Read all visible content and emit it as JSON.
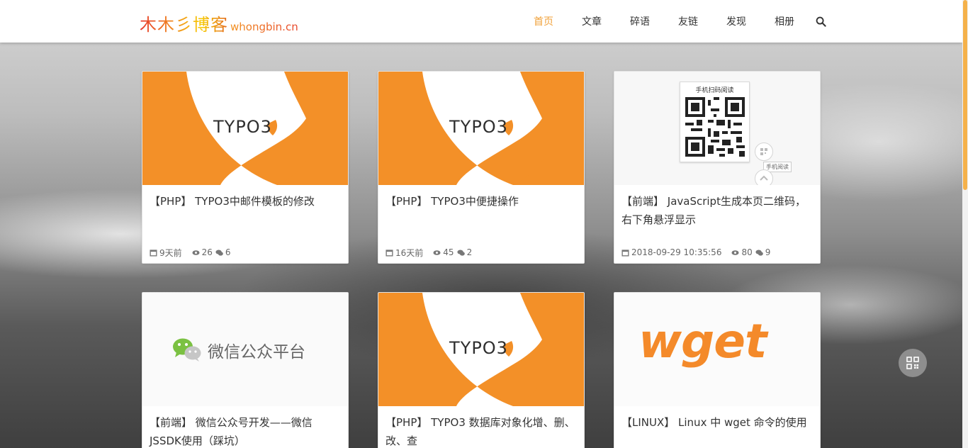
{
  "header": {
    "logo_main": "木木彡博客",
    "logo_sub": "whongbin.cn",
    "nav": [
      "首页",
      "文章",
      "碎语",
      "友链",
      "发现",
      "相册"
    ],
    "active_nav": "首页",
    "search_icon": "search-icon"
  },
  "colors": {
    "accent": "#f0a13a",
    "typo3_orange": "#f39028",
    "wget_orange": "#f48a2a",
    "scroll_thumb": "#f5b14a"
  },
  "posts": [
    {
      "thumb": "typo3-logo",
      "thumb_text": "TYPO3",
      "title": "【PHP】 TYPO3中邮件模板的修改",
      "date": "9天前",
      "views": "26",
      "comments": "6"
    },
    {
      "thumb": "typo3-logo",
      "thumb_text": "TYPO3",
      "title": "【PHP】 TYPO3中便捷操作",
      "date": "16天前",
      "views": "45",
      "comments": "2"
    },
    {
      "thumb": "qr-code",
      "thumb_label": "手机扫码阅读",
      "thumb_tip": "手机阅读",
      "title": "【前端】 JavaScript生成本页二维码，右下角悬浮显示",
      "date": "2018-09-29 10:35:56",
      "views": "80",
      "comments": "9"
    },
    {
      "thumb": "wechat-logo",
      "thumb_text": "微信公众平台",
      "title": "【前端】 微信公众号开发——微信JSSDK使用（踩坑）"
    },
    {
      "thumb": "typo3-logo",
      "thumb_text": "TYPO3",
      "title": "【PHP】 TYPO3 数据库对象化增、删、改、查"
    },
    {
      "thumb": "wget-logo",
      "thumb_text": "wget",
      "title": "【LINUX】 Linux 中 wget 命令的使用"
    }
  ],
  "float_button": "qr-code-icon"
}
